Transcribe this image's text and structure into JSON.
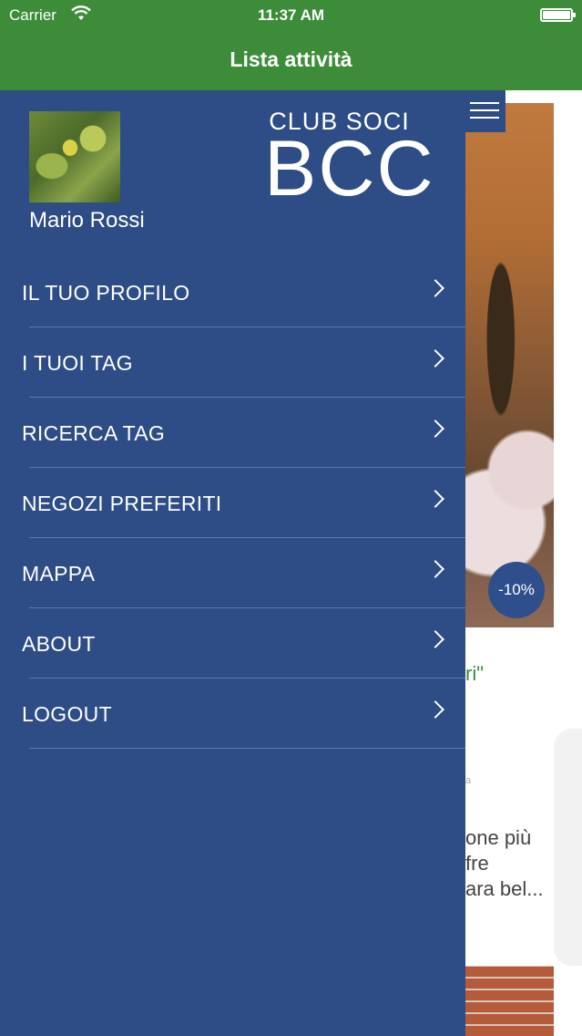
{
  "status_bar": {
    "carrier": "Carrier",
    "time": "11:37 AM"
  },
  "nav": {
    "title": "Lista attività"
  },
  "drawer": {
    "user_name": "Mario Rossi",
    "logo_top": "CLUB SOCI",
    "logo_main": "BCC",
    "menu": [
      {
        "label": "IL TUO PROFILO"
      },
      {
        "label": "I TUOI TAG"
      },
      {
        "label": "RICERCA TAG"
      },
      {
        "label": "NEGOZI PREFERITI"
      },
      {
        "label": "MAPPA"
      },
      {
        "label": "ABOUT"
      },
      {
        "label": "LOGOUT"
      }
    ]
  },
  "background": {
    "badge": "-10%",
    "quote_fragment": "ri\"",
    "small_text": "a",
    "desc_lines": [
      "one più",
      "fre",
      "ara bel..."
    ]
  },
  "colors": {
    "nav_green": "#3c8c3a",
    "drawer_blue": "#2e4c85",
    "separator": "#5d78aa"
  }
}
